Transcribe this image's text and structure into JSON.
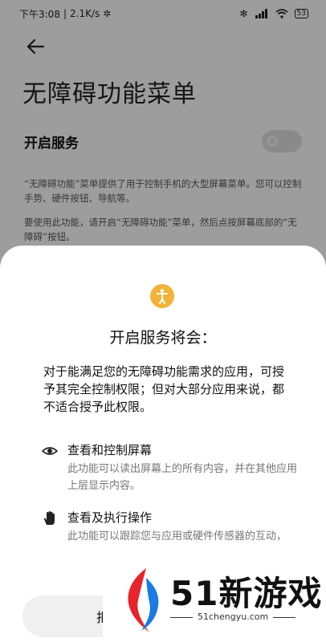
{
  "status_bar": {
    "time": "下午3:08",
    "speed": "2.1K/s",
    "battery": "53"
  },
  "page": {
    "title": "无障碍功能菜单",
    "service_label": "开启服务",
    "service_enabled": false,
    "description_1": "“无障碍功能”菜单提供了用于控制手机的大型屏幕菜单。您可以控制手势、硬件按钮、导航等。",
    "description_2": "要使用此功能，请开启“无障碍功能”菜单，然后点按屏幕底部的“无障碍”按钮。"
  },
  "sheet": {
    "title": "开启服务将会：",
    "description": "对于能满足您的无障碍功能需求的应用，可授予其完全控制权限；但对大部分应用来说，都不适合授予此权限。",
    "permissions": [
      {
        "title": "查看和控制屏幕",
        "description": "此功能可以读出屏幕上的所有内容，并在其他应用上层显示内容。",
        "icon": "eye-icon"
      },
      {
        "title": "查看及执行操作",
        "description": "此功能可以跟踪您与应用或硬件传感器的互动，",
        "icon": "hand-icon"
      }
    ],
    "deny_label": "拒绝"
  },
  "watermark": {
    "text": "51新游戏",
    "url": "51chengyu.com"
  },
  "colors": {
    "badge": "#f2b33a",
    "logo_red": "#e8232a",
    "logo_blue": "#1a7be0"
  }
}
